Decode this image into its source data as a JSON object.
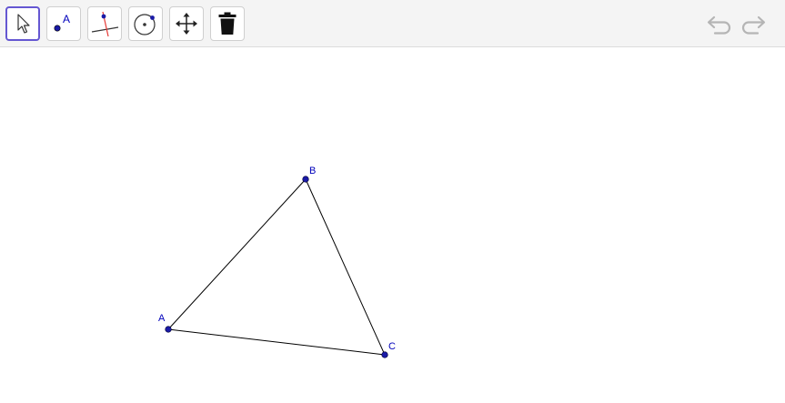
{
  "toolbar": {
    "tools": [
      {
        "id": "move",
        "icon": "cursor-arrow-icon",
        "selected": true
      },
      {
        "id": "point",
        "icon": "point-icon",
        "label": "A",
        "selected": false
      },
      {
        "id": "perpendicular-bisector",
        "icon": "perpendicular-bisector-icon",
        "selected": false
      },
      {
        "id": "circle",
        "icon": "circle-with-center-icon",
        "selected": false
      },
      {
        "id": "move-graphics-view",
        "icon": "move-arrows-icon",
        "selected": false
      },
      {
        "id": "delete",
        "icon": "trash-icon",
        "selected": false
      }
    ],
    "undo_icon": "undo-icon",
    "redo_icon": "redo-icon"
  },
  "construction": {
    "points": [
      {
        "name": "A",
        "label": "A"
      },
      {
        "name": "B",
        "label": "B"
      },
      {
        "name": "C",
        "label": "C"
      }
    ],
    "segments": [
      {
        "from": "A",
        "to": "B"
      },
      {
        "from": "B",
        "to": "C"
      },
      {
        "from": "C",
        "to": "A"
      }
    ],
    "colors": {
      "point": "#1a1aa6",
      "label": "#0000bb",
      "segment": "#000000",
      "selected_tool_border": "#6557d2",
      "bisector_line": "#e53935"
    }
  }
}
